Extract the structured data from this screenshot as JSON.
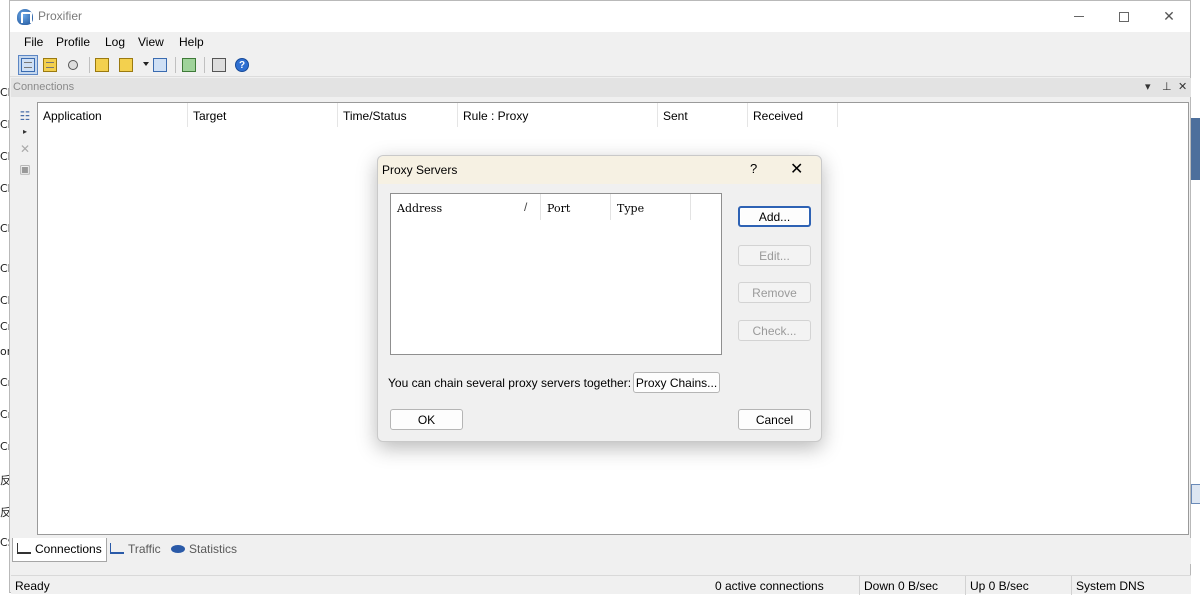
{
  "window": {
    "title": "Proxifier",
    "controls": {
      "minimize": "",
      "maximize": "",
      "close": "✕"
    }
  },
  "menu": [
    "File",
    "Profile",
    "Log",
    "View",
    "Help"
  ],
  "panel": {
    "title": "Connections",
    "controls": [
      "▾",
      "⊥",
      "✕"
    ]
  },
  "columns": [
    "Application",
    "Target",
    "Time/Status",
    "Rule : Proxy",
    "Sent",
    "Received"
  ],
  "tabs": [
    {
      "label": "Connections",
      "active": true
    },
    {
      "label": "Traffic",
      "active": false
    },
    {
      "label": "Statistics",
      "active": false
    }
  ],
  "status": {
    "ready": "Ready",
    "active_connections": "0 active connections",
    "down": "Down 0 B/sec",
    "up": "Up 0 B/sec",
    "dns": "System DNS"
  },
  "dialog": {
    "title": "Proxy Servers",
    "help": "?",
    "close": "✕",
    "list_columns": {
      "address": "Address",
      "sort": "/",
      "port": "Port",
      "type": "Type"
    },
    "buttons": {
      "add": "Add...",
      "edit": "Edit...",
      "remove": "Remove",
      "check": "Check...",
      "proxy_chains": "Proxy Chains...",
      "ok": "OK",
      "cancel": "Cancel"
    },
    "chain_text": "You can chain several proxy servers together:"
  }
}
